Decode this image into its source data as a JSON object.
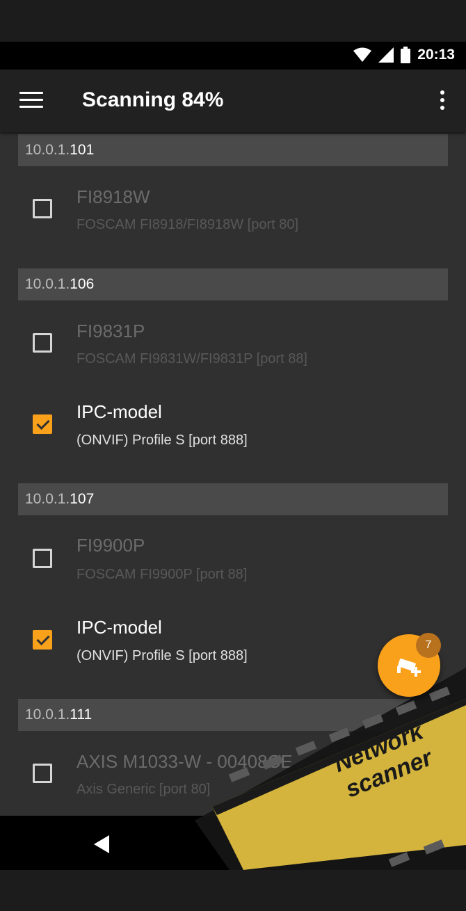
{
  "status_bar": {
    "time": "20:13"
  },
  "app_bar": {
    "title": "Scanning 84%"
  },
  "groups": [
    {
      "ip_prefix": "10.0.1.",
      "ip_last": "101",
      "devices": [
        {
          "name": "FI8918W",
          "detail": "FOSCAM FI8918/FI8918W [port 80]",
          "checked": false
        }
      ]
    },
    {
      "ip_prefix": "10.0.1.",
      "ip_last": "106",
      "devices": [
        {
          "name": "FI9831P",
          "detail": "FOSCAM FI9831W/FI9831P [port 88]",
          "checked": false
        },
        {
          "name": "IPC-model",
          "detail": "(ONVIF) Profile S [port 888]",
          "checked": true
        }
      ]
    },
    {
      "ip_prefix": "10.0.1.",
      "ip_last": "107",
      "devices": [
        {
          "name": "FI9900P",
          "detail": "FOSCAM FI9900P [port 88]",
          "checked": false
        },
        {
          "name": "IPC-model",
          "detail": "(ONVIF) Profile S [port 888]",
          "checked": true
        }
      ]
    },
    {
      "ip_prefix": "10.0.1.",
      "ip_last": "111",
      "devices": [
        {
          "name": "AXIS M1033-W - 00408CE",
          "detail": "Axis Generic [port 80]",
          "checked": false
        }
      ]
    }
  ],
  "fab": {
    "badge": "7",
    "icon": "add-camera-icon"
  },
  "banner": {
    "line1": "Network",
    "line2": "scanner"
  },
  "colors": {
    "accent": "#f9a11b",
    "banner": "#d4b43c",
    "background": "#303030"
  }
}
